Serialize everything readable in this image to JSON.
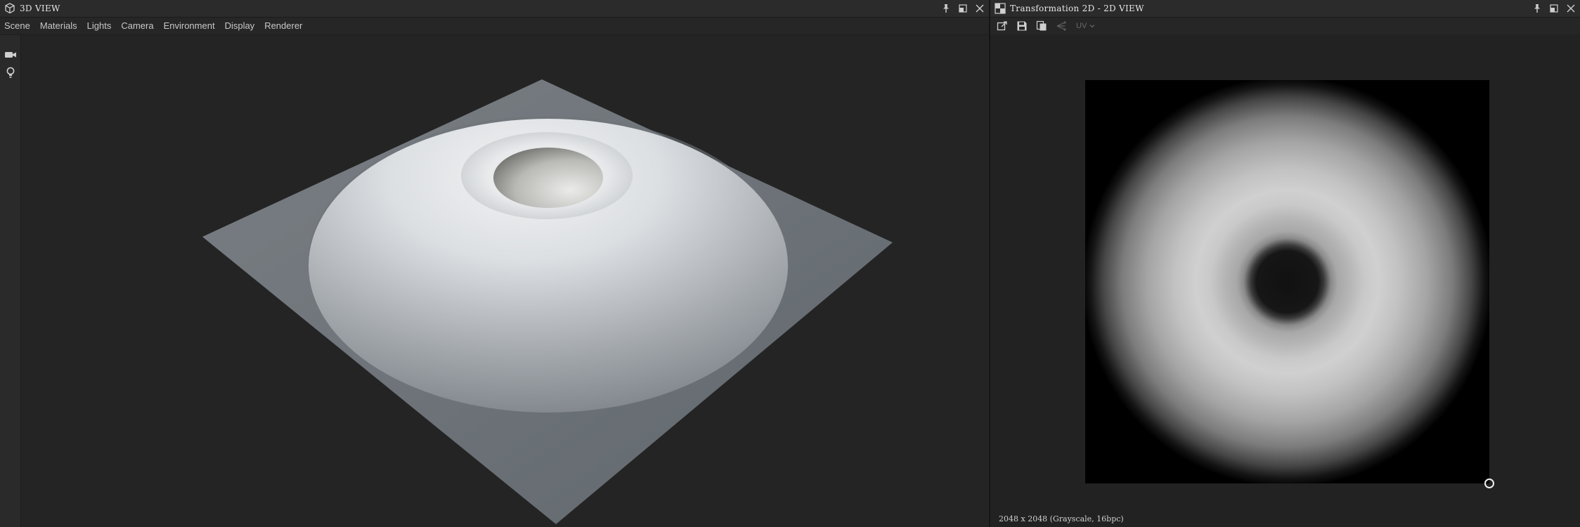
{
  "left_panel": {
    "title": "3D VIEW",
    "icon": "cube-icon",
    "menu": [
      "Scene",
      "Materials",
      "Lights",
      "Camera",
      "Environment",
      "Display",
      "Renderer"
    ],
    "side_tools": [
      "camera-icon",
      "lightbulb-icon"
    ],
    "controls": [
      "pin-icon",
      "maximize-icon",
      "close-icon"
    ]
  },
  "right_panel": {
    "title": "Transformation 2D - 2D VIEW",
    "icon": "checker-icon",
    "toolbar": [
      "export-icon",
      "save-icon",
      "copy-icon",
      "share-icon"
    ],
    "uv_select": "UV",
    "status": "2048 x 2048 (Grayscale, 16bpc)",
    "controls": [
      "pin-icon",
      "maximize-icon",
      "close-icon"
    ]
  },
  "colors": {
    "background": "#222222",
    "titlebar": "#2b2b2b",
    "plane": "#6e7479",
    "text": "#e6e6e6"
  }
}
